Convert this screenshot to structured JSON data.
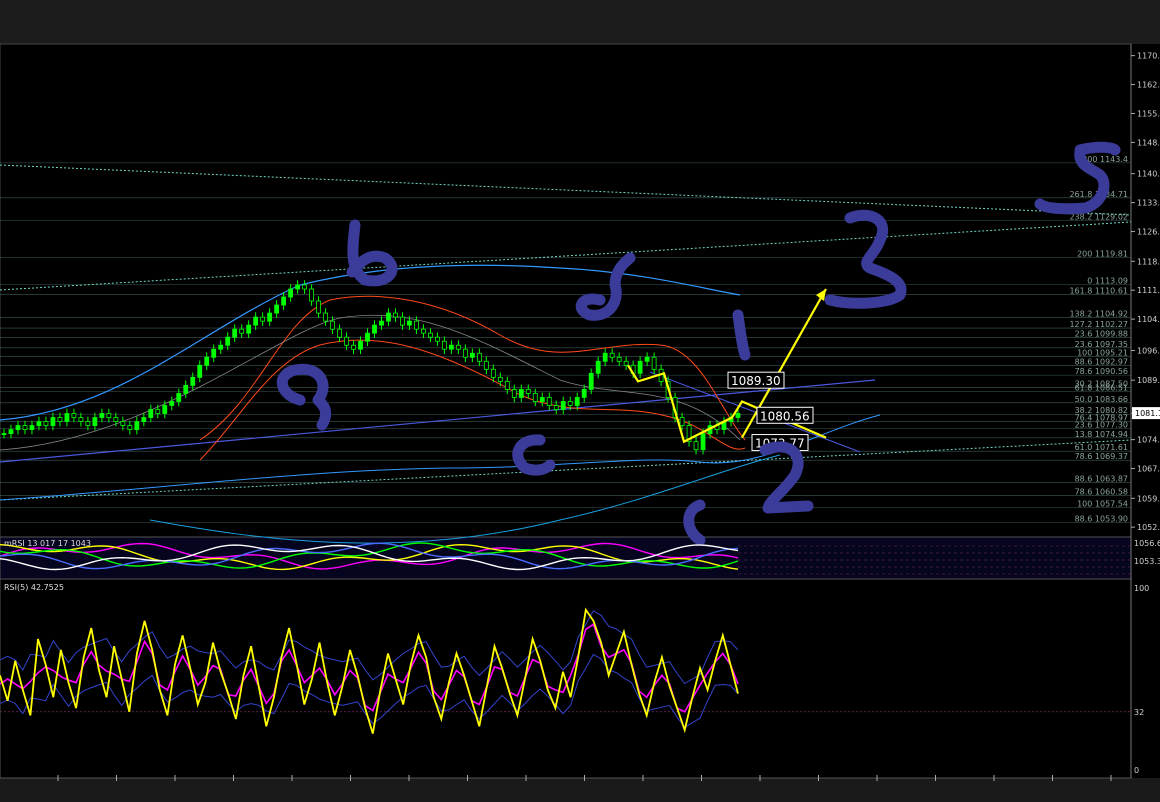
{
  "chart_data": [
    {
      "type": "line",
      "title": "",
      "ylim": [
        1052.0,
        1172.0
      ],
      "y_ticks": [
        "1170.1",
        "1162.9",
        "1155.7",
        "1148.5",
        "1140.7",
        "1133.5",
        "1126.3",
        "1118.9",
        "1111.7",
        "1104.5",
        "1096.7",
        "1089.3",
        "1081.1",
        "1074.5",
        "1067.3",
        "1059.9",
        "1052.7"
      ],
      "price_series": [
        1076,
        1077,
        1078,
        1077,
        1078,
        1079,
        1078,
        1080,
        1079,
        1081,
        1080,
        1079,
        1078,
        1080,
        1081,
        1080,
        1079,
        1078,
        1077,
        1079,
        1080,
        1082,
        1081,
        1083,
        1084,
        1086,
        1088,
        1090,
        1093,
        1095,
        1097,
        1098,
        1100,
        1102,
        1101,
        1103,
        1105,
        1104,
        1106,
        1108,
        1110,
        1112,
        1113,
        1112,
        1109,
        1106,
        1104,
        1102,
        1100,
        1098,
        1097,
        1099,
        1101,
        1103,
        1104,
        1106,
        1105,
        1103,
        1104,
        1102,
        1101,
        1100,
        1099,
        1097,
        1098,
        1097,
        1095,
        1096,
        1094,
        1092,
        1090,
        1089,
        1087,
        1085,
        1087,
        1086,
        1084,
        1085,
        1083,
        1082,
        1084,
        1083,
        1085,
        1087,
        1091,
        1094,
        1096,
        1095,
        1094,
        1093,
        1091,
        1094,
        1095,
        1092,
        1089,
        1085,
        1080,
        1078,
        1074,
        1072,
        1076,
        1078,
        1077,
        1079,
        1080,
        1081
      ],
      "fib_levels": [
        {
          "label": "300 1143.4",
          "value": 1143.4
        },
        {
          "label": "261.8 1134.71",
          "value": 1134.71
        },
        {
          "label": "238.2 1129.02",
          "value": 1129.02
        },
        {
          "label": "200 1119.81",
          "value": 1119.81
        },
        {
          "label": "0 1113.09",
          "value": 1113.09
        },
        {
          "label": "161.8 1110.61",
          "value": 1110.61
        },
        {
          "label": "138.2 1104.92",
          "value": 1104.92
        },
        {
          "label": "127.2 1102.27",
          "value": 1102.27
        },
        {
          "label": "23.6 1099.88",
          "value": 1099.88
        },
        {
          "label": "23.6 1097.35",
          "value": 1097.35
        },
        {
          "label": "100 1095.21",
          "value": 1095.21
        },
        {
          "label": "88.6 1092.97",
          "value": 1092.97
        },
        {
          "label": "78.6 1090.56",
          "value": 1090.56
        },
        {
          "label": "30.2 1087.50",
          "value": 1087.5
        },
        {
          "label": "61.8 1086.51",
          "value": 1086.51
        },
        {
          "label": "50.0 1083.66",
          "value": 1083.66
        },
        {
          "label": "38.2 1080.82",
          "value": 1080.82
        },
        {
          "label": "76.4 1078.97",
          "value": 1078.97
        },
        {
          "label": "23.6 1077.30",
          "value": 1077.3
        },
        {
          "label": "13.8 1074.94",
          "value": 1074.94
        },
        {
          "label": "61.0 1071.61",
          "value": 1071.61
        },
        {
          "label": "78.6 1069.37",
          "value": 1069.37
        },
        {
          "label": "88.6 1063.87",
          "value": 1063.87
        },
        {
          "label": "78.6 1060.58",
          "value": 1060.58
        },
        {
          "label": "100 1057.54",
          "value": 1057.54
        },
        {
          "label": "88.6 1053.90",
          "value": 1053.9
        }
      ],
      "current_price": "1081.1",
      "price_labels": [
        {
          "text": "1089.30",
          "value": 1089.3
        },
        {
          "text": "1080.56",
          "value": 1080.56
        },
        {
          "text": "1073.77",
          "value": 1073.77
        }
      ],
      "wave_annotations": [
        {
          "text": "a",
          "note": "handwritten"
        },
        {
          "text": "b",
          "note": "handwritten"
        },
        {
          "text": "c",
          "note": "handwritten"
        },
        {
          "text": "d",
          "note": "handwritten"
        },
        {
          "text": "e",
          "note": "handwritten"
        },
        {
          "text": "1",
          "note": "handwritten"
        },
        {
          "text": "2",
          "note": "handwritten"
        },
        {
          "text": "3",
          "note": "handwritten"
        },
        {
          "text": "5",
          "note": "handwritten"
        }
      ],
      "yellow_path": [
        1093,
        1089,
        1091,
        1074,
        1080,
        1084,
        1075,
        1112
      ],
      "colors": {
        "up": "#00ff00",
        "down": "#00ff00",
        "annotation": "#3b3b9a",
        "path": "#ffff00",
        "fib": "#6fa59a",
        "ma_blue": "#3399ff",
        "ma_red": "#ff4a1a"
      }
    },
    {
      "type": "line",
      "title": "mRSI 13 017 17 1043",
      "ylim": [
        0,
        100
      ],
      "y_ticks": [
        "1056.6",
        "1053.3"
      ],
      "colors": {
        "a": "#ff00ff",
        "b": "#ffff00",
        "c": "#00ff00"
      }
    },
    {
      "type": "line",
      "title": "RSI(5) 42.7525",
      "ylim": [
        0,
        100
      ],
      "y_ticks": [
        "100",
        "32",
        "0"
      ],
      "level": 32,
      "rsi_values": [
        52,
        38,
        60,
        44,
        30,
        72,
        58,
        40,
        66,
        48,
        34,
        62,
        78,
        55,
        40,
        68,
        50,
        32,
        64,
        82,
        66,
        44,
        30,
        58,
        74,
        56,
        36,
        48,
        70,
        54,
        42,
        28,
        52,
        68,
        46,
        24,
        40,
        62,
        78,
        58,
        36,
        50,
        70,
        48,
        30,
        46,
        66,
        52,
        34,
        20,
        44,
        64,
        50,
        36,
        58,
        74,
        62,
        40,
        28,
        48,
        64,
        52,
        38,
        24,
        46,
        68,
        56,
        42,
        30,
        50,
        72,
        60,
        44,
        34,
        54,
        40,
        62,
        88,
        82,
        70,
        52,
        64,
        76,
        58,
        42,
        30,
        48,
        62,
        46,
        34,
        22,
        40,
        56,
        44,
        60,
        74,
        58,
        42
      ],
      "colors": {
        "rsi": "#ffff00",
        "signal": "#ff00ff",
        "bands": "#3344cc"
      }
    }
  ]
}
